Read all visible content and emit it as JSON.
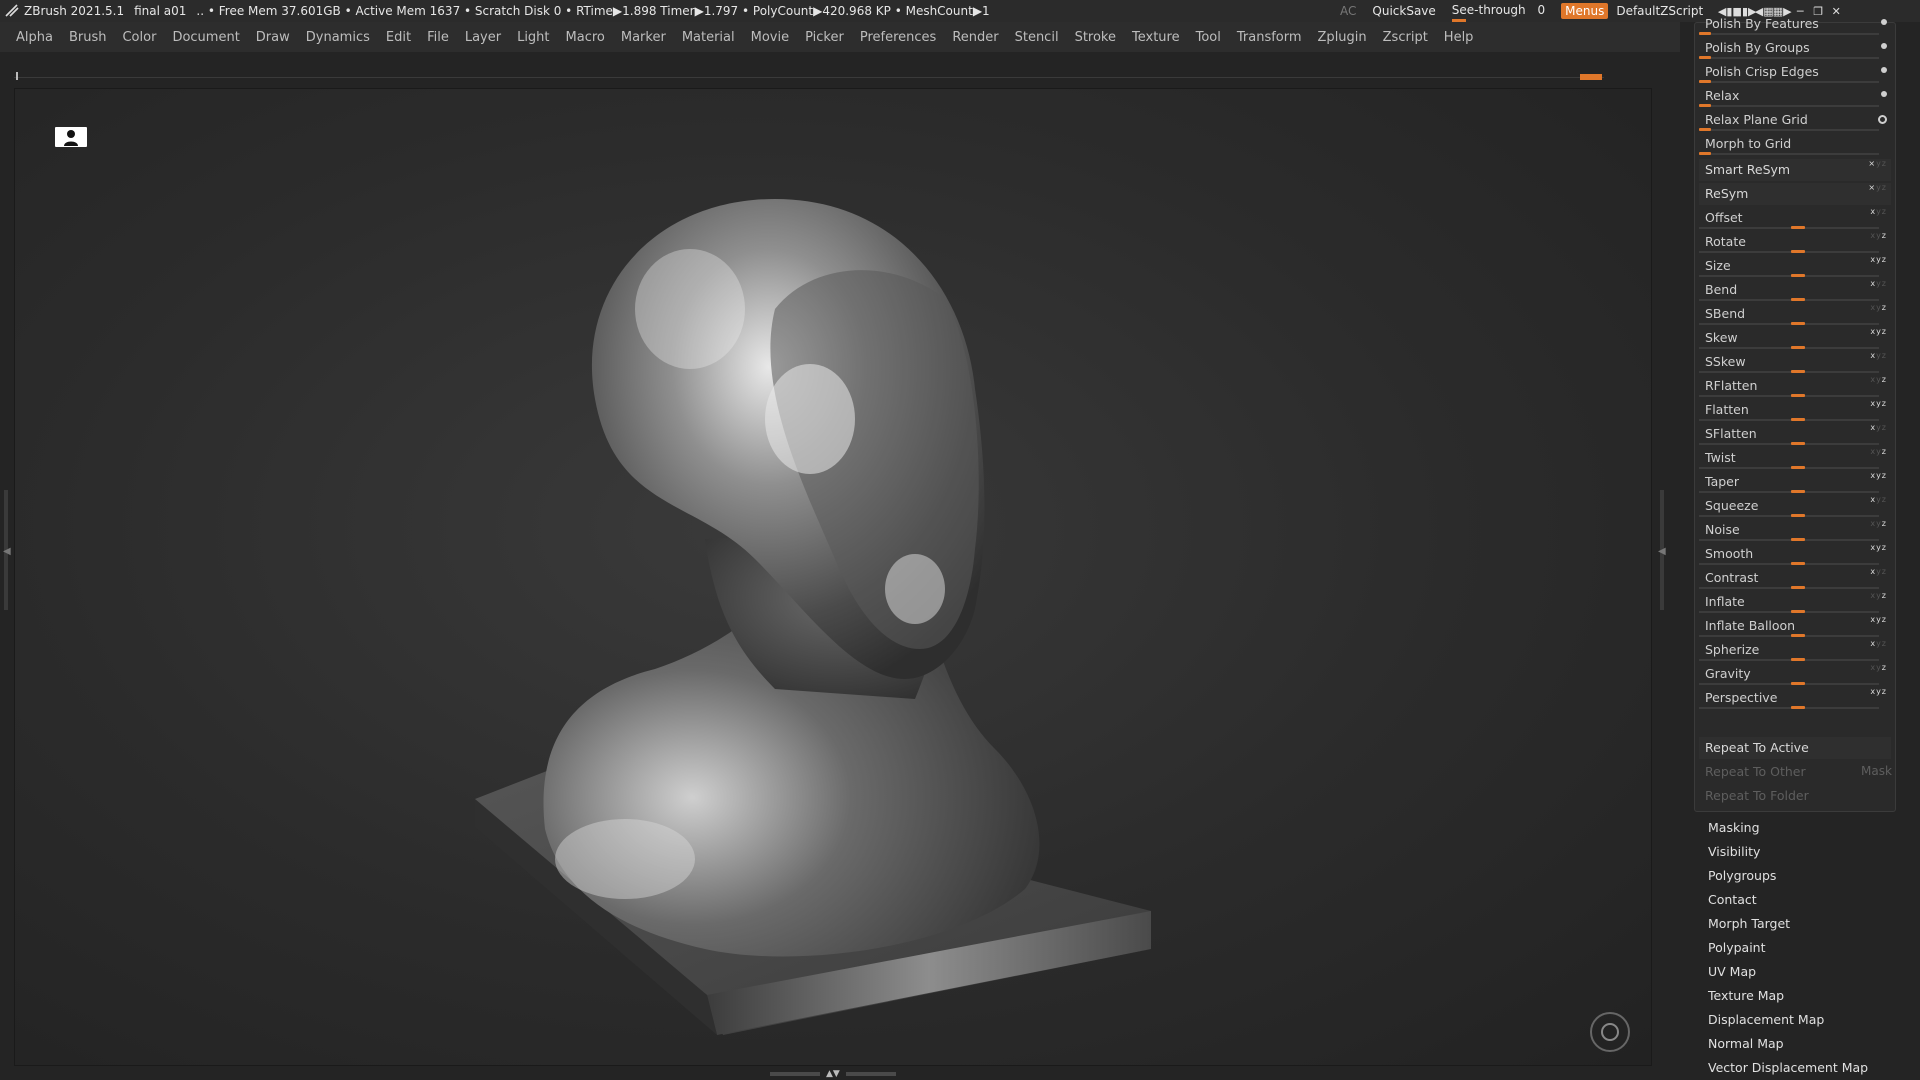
{
  "titlebar": {
    "app": "ZBrush 2021.5.1",
    "file": "final a01",
    "stats": ".. • Free Mem 37.601GB • Active Mem 1637 • Scratch Disk 0 •  RTime▶1.898 Timer▶1.797 • PolyCount▶420.968 KP  • MeshCount▶1",
    "ac": "AC",
    "quicksave": "QuickSave",
    "see_through": "See-through",
    "see_through_value": "0",
    "menus": "Menus",
    "script": "DefaultZScript"
  },
  "menubar": [
    "Alpha",
    "Brush",
    "Color",
    "Document",
    "Draw",
    "Dynamics",
    "Edit",
    "File",
    "Layer",
    "Light",
    "Macro",
    "Marker",
    "Material",
    "Movie",
    "Picker",
    "Preferences",
    "Render",
    "Stencil",
    "Stroke",
    "Texture",
    "Tool",
    "Transform",
    "Zplugin",
    "Zscript",
    "Help"
  ],
  "deformation": {
    "top_rows": [
      {
        "label": "Polish By Features",
        "marker": "dot"
      },
      {
        "label": "Polish By Groups",
        "marker": "dot"
      },
      {
        "label": "Polish Crisp Edges",
        "marker": "dot"
      },
      {
        "label": "Relax",
        "marker": "dot"
      },
      {
        "label": "Relax Plane Grid",
        "marker": "hollow"
      },
      {
        "label": "Morph to Grid",
        "marker": "none"
      }
    ],
    "buttons": [
      {
        "label": "Smart ReSym"
      },
      {
        "label": "ReSym"
      }
    ],
    "sliders": [
      {
        "label": "Offset"
      },
      {
        "label": "Rotate"
      },
      {
        "label": "Size"
      },
      {
        "label": "Bend"
      },
      {
        "label": "SBend"
      },
      {
        "label": "Skew"
      },
      {
        "label": "SSkew"
      },
      {
        "label": "RFlatten"
      },
      {
        "label": "Flatten"
      },
      {
        "label": "SFlatten"
      },
      {
        "label": "Twist"
      },
      {
        "label": "Taper"
      },
      {
        "label": "Squeeze"
      },
      {
        "label": "Noise"
      },
      {
        "label": "Smooth"
      },
      {
        "label": "Contrast"
      },
      {
        "label": "Inflate"
      },
      {
        "label": "Inflate Balloon"
      },
      {
        "label": "Spherize"
      },
      {
        "label": "Gravity"
      },
      {
        "label": "Perspective"
      }
    ],
    "repeat_active": "Repeat To Active",
    "repeat_other": "Repeat To Other",
    "mask": "Mask",
    "repeat_folder": "Repeat To Folder"
  },
  "subpalettes": [
    "Masking",
    "Visibility",
    "Polygroups",
    "Contact",
    "Morph Target",
    "Polypaint",
    "UV Map",
    "Texture Map",
    "Displacement Map",
    "Normal Map",
    "Vector Displacement Map"
  ],
  "colors": {
    "accent": "#e0772a",
    "panel": "#2a2a2a",
    "viewport": "#2b2b2b"
  }
}
